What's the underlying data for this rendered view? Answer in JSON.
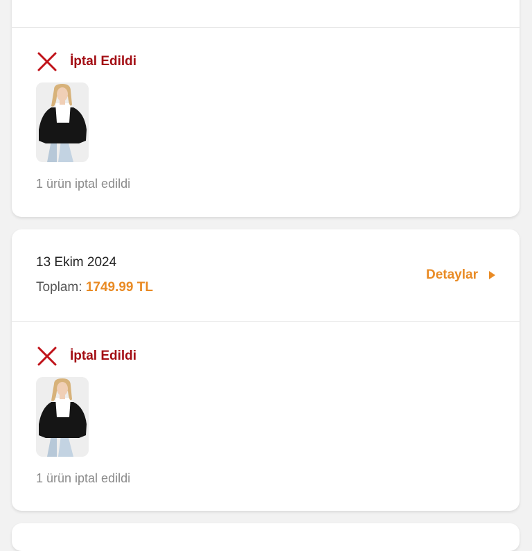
{
  "orders": [
    {
      "status": "İptal Edildi",
      "note": "1 ürün iptal edildi",
      "product_image": "woman-black-jacket-photo"
    },
    {
      "date": "13 Ekim 2024",
      "total_label": "Toplam:",
      "total_value": "1749.99 TL",
      "details_label": "Detaylar",
      "status": "İptal Edildi",
      "note": "1 ürün iptal edildi",
      "product_image": "woman-black-jacket-photo"
    }
  ],
  "colors": {
    "accent": "#e98b25",
    "cancelled": "#a30e14",
    "background": "#f2f2f2"
  },
  "icons": [
    "close-x-icon",
    "arrow-right-icon"
  ]
}
